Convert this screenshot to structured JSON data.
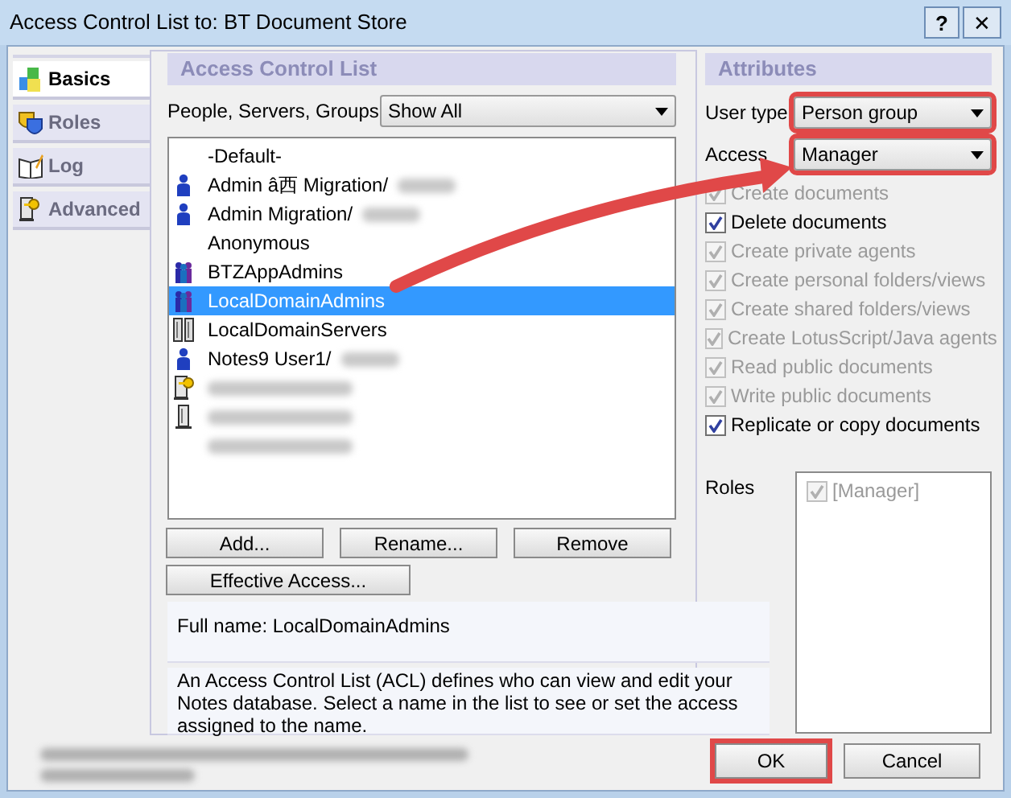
{
  "window": {
    "title": "Access Control List to: BT Document Store",
    "help": "?",
    "close": "✕"
  },
  "tabs": [
    {
      "label": "Basics",
      "selected": true
    },
    {
      "label": "Roles",
      "selected": false
    },
    {
      "label": "Log",
      "selected": false
    },
    {
      "label": "Advanced",
      "selected": false
    }
  ],
  "acl": {
    "header": "Access Control List",
    "filter_label": "People, Servers, Groups",
    "filter_value": "Show All",
    "entries": [
      {
        "name": "-Default-",
        "kind": "none",
        "selected": false,
        "redacted": false
      },
      {
        "name": "Admin â西 Migration/",
        "kind": "person",
        "selected": false,
        "redacted": true
      },
      {
        "name": "Admin Migration/",
        "kind": "person",
        "selected": false,
        "redacted": true
      },
      {
        "name": "Anonymous",
        "kind": "none",
        "selected": false,
        "redacted": false
      },
      {
        "name": "BTZAppAdmins",
        "kind": "group",
        "selected": false,
        "redacted": false
      },
      {
        "name": "LocalDomainAdmins",
        "kind": "group",
        "selected": true,
        "redacted": false
      },
      {
        "name": "LocalDomainServers",
        "kind": "servergroup",
        "selected": false,
        "redacted": false
      },
      {
        "name": "Notes9 User1/",
        "kind": "person",
        "selected": false,
        "redacted": true
      },
      {
        "kind": "keyserver",
        "selected": false,
        "redacted": true
      },
      {
        "kind": "server",
        "selected": false,
        "redacted": true
      },
      {
        "kind": "none",
        "selected": false,
        "redacted": true
      }
    ],
    "buttons": [
      "Add...",
      "Rename...",
      "Remove"
    ],
    "effective_access": "Effective Access...",
    "full_name": "Full name: LocalDomainAdmins",
    "description": "An Access Control List (ACL) defines who can view and edit your Notes database.  Select a name in the list to see or set the access assigned to the name."
  },
  "attributes": {
    "header": "Attributes",
    "user_type": {
      "label": "User type",
      "value": "Person group",
      "highlighted": true
    },
    "access": {
      "label": "Access",
      "value": "Manager",
      "highlighted": true
    },
    "permissions": [
      {
        "label": "Create documents",
        "checked": true,
        "disabled": true
      },
      {
        "label": "Delete documents",
        "checked": true,
        "disabled": false
      },
      {
        "label": "Create private agents",
        "checked": true,
        "disabled": true
      },
      {
        "label": "Create personal folders/views",
        "checked": true,
        "disabled": true
      },
      {
        "label": "Create shared folders/views",
        "checked": true,
        "disabled": true
      },
      {
        "label": "Create LotusScript/Java agents",
        "checked": true,
        "disabled": true
      },
      {
        "label": "Read public documents",
        "checked": true,
        "disabled": true
      },
      {
        "label": "Write public documents",
        "checked": true,
        "disabled": true
      },
      {
        "label": "Replicate or copy documents",
        "checked": true,
        "disabled": false
      }
    ],
    "roles_label": "Roles",
    "roles": [
      {
        "label": "[Manager]",
        "checked": true,
        "disabled": true
      }
    ]
  },
  "last_change": {
    "redacted": true
  },
  "annotation_arrow": true,
  "footer_buttons": [
    {
      "label": "OK",
      "highlighted": true
    },
    {
      "label": "Cancel",
      "highlighted": false
    }
  ]
}
